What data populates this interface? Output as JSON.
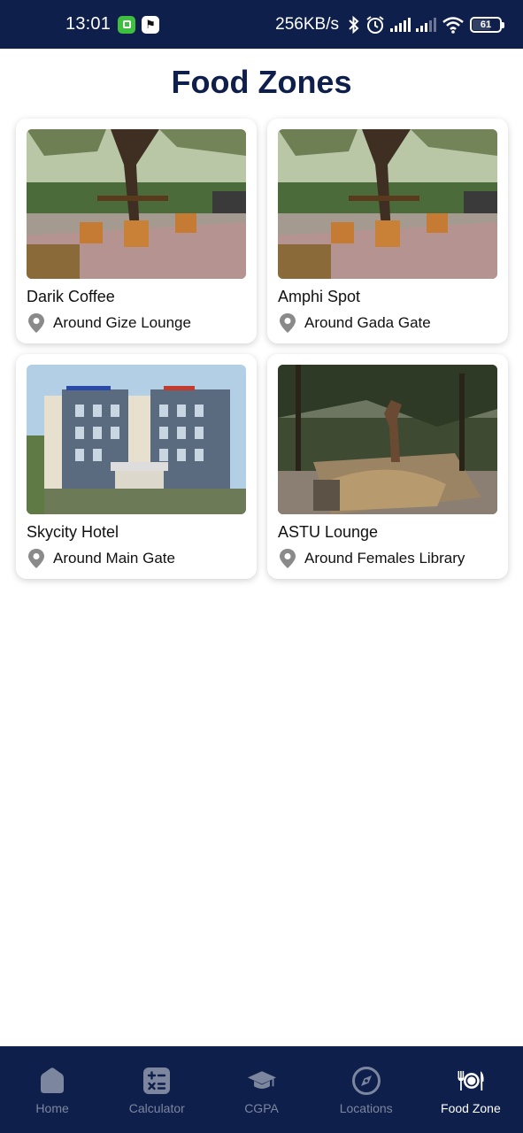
{
  "status_bar": {
    "time": "13:01",
    "speed": "256KB/s",
    "battery": "61"
  },
  "page": {
    "title": "Food Zones"
  },
  "cards": [
    {
      "name": "Darik Coffee",
      "location": "Around Gize Lounge",
      "image": "outdoor-cafe-under-trees"
    },
    {
      "name": "Amphi Spot",
      "location": "Around Gada Gate",
      "image": "outdoor-cafe-under-trees"
    },
    {
      "name": "Skycity Hotel",
      "location": "Around Main Gate",
      "image": "hotel-building"
    },
    {
      "name": "ASTU Lounge",
      "location": "Around Females Library",
      "image": "garden-with-statue"
    }
  ],
  "bottom_nav": {
    "items": [
      {
        "label": "Home",
        "icon": "home-icon",
        "active": false
      },
      {
        "label": "Calculator",
        "icon": "calculator-icon",
        "active": false
      },
      {
        "label": "CGPA",
        "icon": "graduation-cap-icon",
        "active": false
      },
      {
        "label": "Locations",
        "icon": "compass-icon",
        "active": false
      },
      {
        "label": "Food Zone",
        "icon": "utensils-plate-icon",
        "active": true
      }
    ]
  },
  "colors": {
    "navy": "#0f1f4b",
    "inactive_nav": "#7c869e",
    "pin_gray": "#8a8a8a"
  }
}
